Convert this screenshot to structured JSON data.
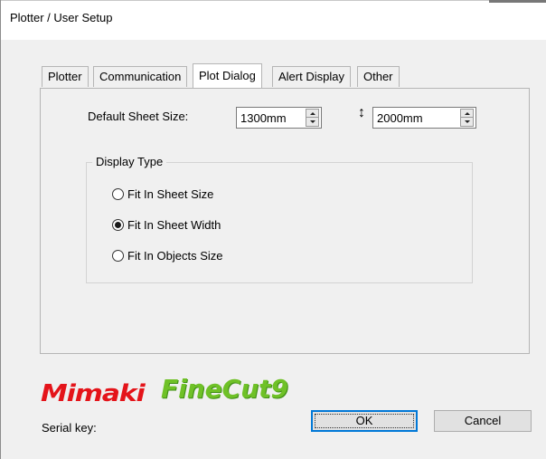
{
  "window": {
    "title": "Plotter / User Setup"
  },
  "tabs": [
    {
      "label": "Plotter",
      "active": false
    },
    {
      "label": "Communication",
      "active": false
    },
    {
      "label": "Plot Dialog",
      "active": true
    },
    {
      "label": "Alert Display",
      "active": false
    },
    {
      "label": "Other",
      "active": false
    }
  ],
  "sheet": {
    "label": "Default Sheet Size:",
    "width_icon": "horizontal-arrows-icon",
    "width_value": "1300mm",
    "height_icon": "vertical-arrows-icon",
    "height_value": "2000mm"
  },
  "display_type": {
    "title": "Display Type",
    "options": [
      {
        "label": "Fit In Sheet Size",
        "checked": false
      },
      {
        "label": "Fit In Sheet Width",
        "checked": true
      },
      {
        "label": "Fit In Objects Size",
        "checked": false
      }
    ]
  },
  "logo": {
    "brand": "Mimaki",
    "product": "FineCut9",
    "brand_color": "#e4141a",
    "product_color": "#6fc127"
  },
  "footer": {
    "serial_label": "Serial key:",
    "ok_label": "OK",
    "cancel_label": "Cancel"
  }
}
